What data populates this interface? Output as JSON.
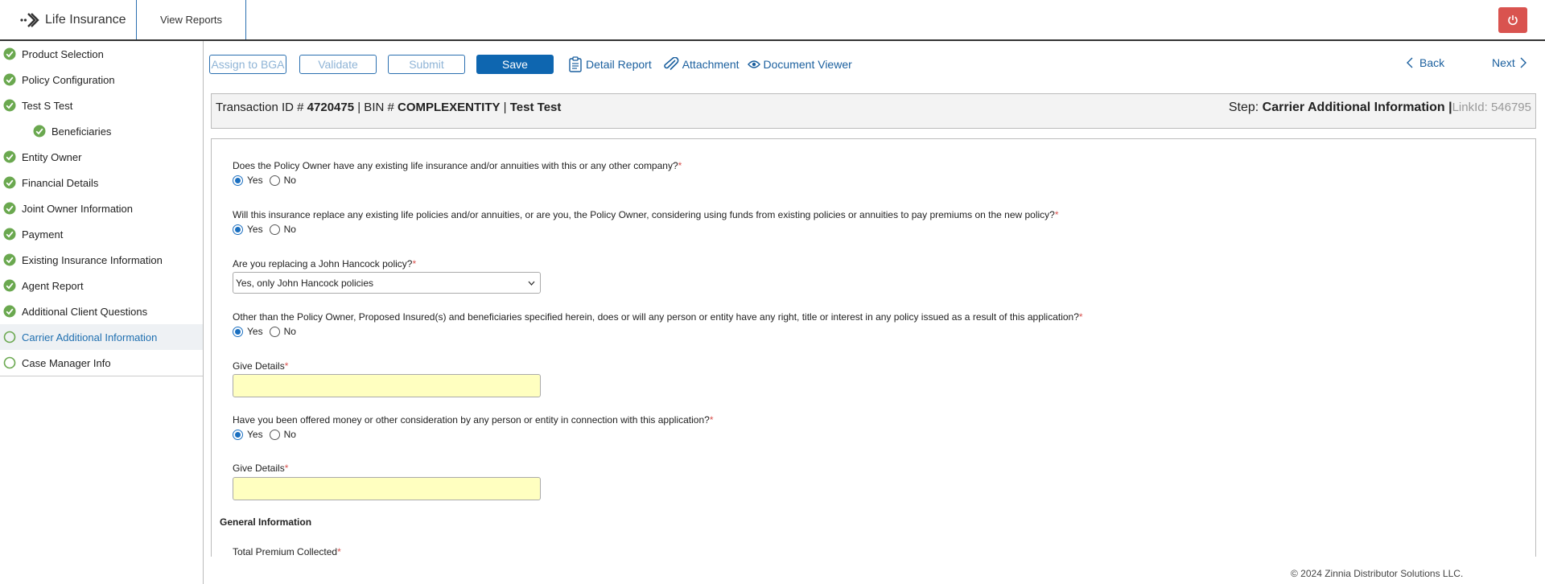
{
  "header": {
    "brand_title": "Life Insurance",
    "view_reports": "View Reports"
  },
  "sidebar": {
    "items": [
      {
        "label": "Product Selection",
        "status": "complete"
      },
      {
        "label": "Policy Configuration",
        "status": "complete"
      },
      {
        "label": "Test S Test",
        "status": "complete"
      },
      {
        "label": "Beneficiaries",
        "status": "complete"
      },
      {
        "label": "Entity Owner",
        "status": "complete"
      },
      {
        "label": "Financial Details",
        "status": "complete"
      },
      {
        "label": "Joint Owner Information",
        "status": "complete"
      },
      {
        "label": "Payment",
        "status": "complete"
      },
      {
        "label": "Existing Insurance Information",
        "status": "complete"
      },
      {
        "label": "Agent Report",
        "status": "complete"
      },
      {
        "label": "Additional Client Questions",
        "status": "complete"
      },
      {
        "label": "Carrier Additional Information",
        "status": "incomplete"
      },
      {
        "label": "Case Manager Info",
        "status": "incomplete"
      }
    ]
  },
  "toolbar": {
    "assign_label": "Assign to BGA",
    "validate_label": "Validate",
    "submit_label": "Submit",
    "save_label": "Save",
    "detail_report_label": "Detail Report",
    "attachment_label": "Attachment",
    "document_viewer_label": "Document Viewer",
    "back_label": "Back",
    "next_label": "Next"
  },
  "info": {
    "transaction_prefix": "Transaction ID # ",
    "transaction_id": "4720475",
    "bin_prefix": " | BIN # ",
    "bin": "COMPLEXENTITY",
    "sep": " | ",
    "name": "Test Test",
    "step_prefix": "Step: ",
    "step": "Carrier Additional Information",
    "link_sep": " |",
    "link_id": "LinkId: 546795"
  },
  "form": {
    "q1": "Does the Policy Owner have any existing life insurance and/or annuities with this or any other company?",
    "q2": "Will this insurance replace any existing life policies and/or annuities, or are you, the Policy Owner, considering using funds from existing policies or annuities to pay premiums on the new policy?",
    "q3": "Are you replacing a John Hancock policy?",
    "q3_value": "Yes, only John Hancock policies",
    "q4": "Other than the Policy Owner, Proposed Insured(s) and beneficiaries specified herein, does or will any person or entity have any right, title or interest in any policy issued as a result of this application?",
    "give_details": "Give Details",
    "q5": "Have you been offered money or other consideration by any person or entity in connection with this application?",
    "yes": "Yes",
    "no": "No",
    "section_general": "General Information",
    "total_premium": "Total Premium Collected",
    "required_mark": "*"
  },
  "footer": {
    "copyright": "© 2024 Zinnia Distributor Solutions LLC."
  },
  "colors": {
    "accent": "#0e66b0",
    "complete": "#6aa84f",
    "power": "#d9534f",
    "input_highlight": "#ffffc0"
  }
}
